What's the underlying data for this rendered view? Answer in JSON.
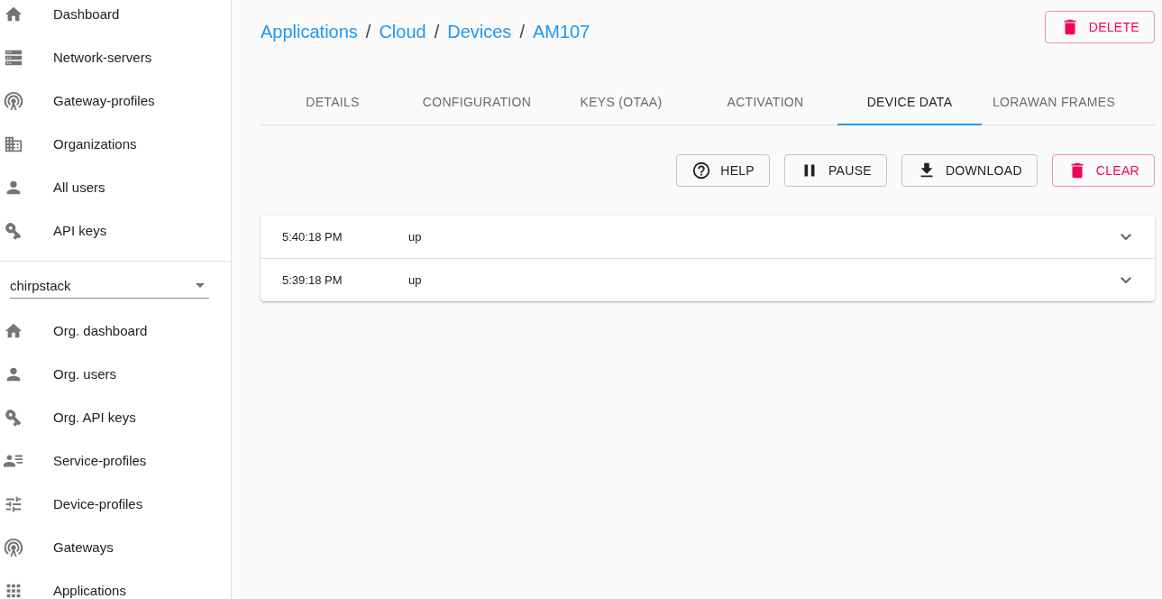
{
  "sidebar": {
    "global_items": [
      {
        "label": "Dashboard",
        "kind": "home"
      },
      {
        "label": "Network-servers",
        "kind": "servers"
      },
      {
        "label": "Gateway-profiles",
        "kind": "antenna"
      },
      {
        "label": "Organizations",
        "kind": "building"
      },
      {
        "label": "All users",
        "kind": "person"
      },
      {
        "label": "API keys",
        "kind": "key"
      }
    ],
    "organization_select": {
      "value": "chirpstack"
    },
    "org_items": [
      {
        "label": "Org. dashboard",
        "kind": "home"
      },
      {
        "label": "Org. users",
        "kind": "person"
      },
      {
        "label": "Org. API keys",
        "kind": "key"
      },
      {
        "label": "Service-profiles",
        "kind": "profile-list"
      },
      {
        "label": "Device-profiles",
        "kind": "tune"
      },
      {
        "label": "Gateways",
        "kind": "antenna"
      },
      {
        "label": "Applications",
        "kind": "apps"
      }
    ]
  },
  "breadcrumb": [
    "Applications",
    "Cloud",
    "Devices",
    "AM107"
  ],
  "breadcrumb_separator": "/",
  "delete_button": {
    "label": "DELETE"
  },
  "tabs": [
    {
      "label": "DETAILS",
      "selected": false
    },
    {
      "label": "CONFIGURATION",
      "selected": false
    },
    {
      "label": "KEYS (OTAA)",
      "selected": false
    },
    {
      "label": "ACTIVATION",
      "selected": false
    },
    {
      "label": "DEVICE DATA",
      "selected": true
    },
    {
      "label": "LORAWAN FRAMES",
      "selected": false
    }
  ],
  "actions": [
    {
      "label": "HELP",
      "kind": "help"
    },
    {
      "label": "PAUSE",
      "kind": "pause"
    },
    {
      "label": "DOWNLOAD",
      "kind": "download"
    },
    {
      "label": "CLEAR",
      "kind": "clear"
    }
  ],
  "events": [
    {
      "time": "5:40:18 PM",
      "type": "up",
      "expanded": false
    },
    {
      "time": "5:39:18 PM",
      "type": "up",
      "expanded": false
    }
  ]
}
